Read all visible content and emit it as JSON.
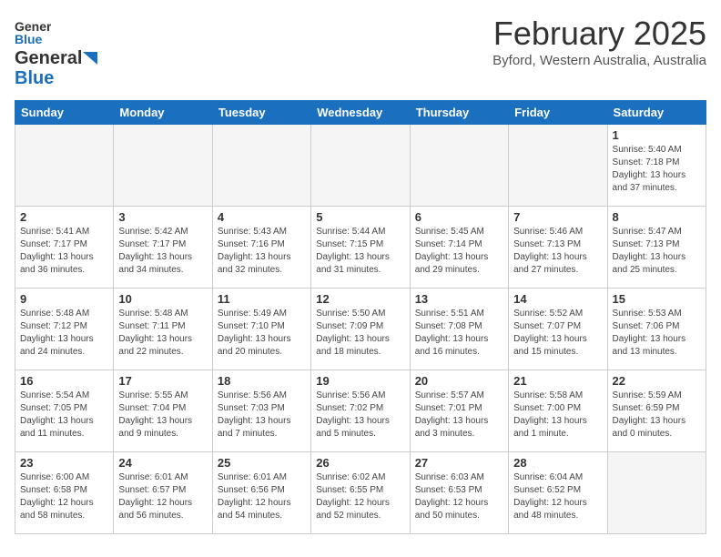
{
  "header": {
    "logo_general": "General",
    "logo_blue": "Blue",
    "month_title": "February 2025",
    "location": "Byford, Western Australia, Australia"
  },
  "weekdays": [
    "Sunday",
    "Monday",
    "Tuesday",
    "Wednesday",
    "Thursday",
    "Friday",
    "Saturday"
  ],
  "weeks": [
    [
      {
        "day": "",
        "info": ""
      },
      {
        "day": "",
        "info": ""
      },
      {
        "day": "",
        "info": ""
      },
      {
        "day": "",
        "info": ""
      },
      {
        "day": "",
        "info": ""
      },
      {
        "day": "",
        "info": ""
      },
      {
        "day": "1",
        "info": "Sunrise: 5:40 AM\nSunset: 7:18 PM\nDaylight: 13 hours\nand 37 minutes."
      }
    ],
    [
      {
        "day": "2",
        "info": "Sunrise: 5:41 AM\nSunset: 7:17 PM\nDaylight: 13 hours\nand 36 minutes."
      },
      {
        "day": "3",
        "info": "Sunrise: 5:42 AM\nSunset: 7:17 PM\nDaylight: 13 hours\nand 34 minutes."
      },
      {
        "day": "4",
        "info": "Sunrise: 5:43 AM\nSunset: 7:16 PM\nDaylight: 13 hours\nand 32 minutes."
      },
      {
        "day": "5",
        "info": "Sunrise: 5:44 AM\nSunset: 7:15 PM\nDaylight: 13 hours\nand 31 minutes."
      },
      {
        "day": "6",
        "info": "Sunrise: 5:45 AM\nSunset: 7:14 PM\nDaylight: 13 hours\nand 29 minutes."
      },
      {
        "day": "7",
        "info": "Sunrise: 5:46 AM\nSunset: 7:13 PM\nDaylight: 13 hours\nand 27 minutes."
      },
      {
        "day": "8",
        "info": "Sunrise: 5:47 AM\nSunset: 7:13 PM\nDaylight: 13 hours\nand 25 minutes."
      }
    ],
    [
      {
        "day": "9",
        "info": "Sunrise: 5:48 AM\nSunset: 7:12 PM\nDaylight: 13 hours\nand 24 minutes."
      },
      {
        "day": "10",
        "info": "Sunrise: 5:48 AM\nSunset: 7:11 PM\nDaylight: 13 hours\nand 22 minutes."
      },
      {
        "day": "11",
        "info": "Sunrise: 5:49 AM\nSunset: 7:10 PM\nDaylight: 13 hours\nand 20 minutes."
      },
      {
        "day": "12",
        "info": "Sunrise: 5:50 AM\nSunset: 7:09 PM\nDaylight: 13 hours\nand 18 minutes."
      },
      {
        "day": "13",
        "info": "Sunrise: 5:51 AM\nSunset: 7:08 PM\nDaylight: 13 hours\nand 16 minutes."
      },
      {
        "day": "14",
        "info": "Sunrise: 5:52 AM\nSunset: 7:07 PM\nDaylight: 13 hours\nand 15 minutes."
      },
      {
        "day": "15",
        "info": "Sunrise: 5:53 AM\nSunset: 7:06 PM\nDaylight: 13 hours\nand 13 minutes."
      }
    ],
    [
      {
        "day": "16",
        "info": "Sunrise: 5:54 AM\nSunset: 7:05 PM\nDaylight: 13 hours\nand 11 minutes."
      },
      {
        "day": "17",
        "info": "Sunrise: 5:55 AM\nSunset: 7:04 PM\nDaylight: 13 hours\nand 9 minutes."
      },
      {
        "day": "18",
        "info": "Sunrise: 5:56 AM\nSunset: 7:03 PM\nDaylight: 13 hours\nand 7 minutes."
      },
      {
        "day": "19",
        "info": "Sunrise: 5:56 AM\nSunset: 7:02 PM\nDaylight: 13 hours\nand 5 minutes."
      },
      {
        "day": "20",
        "info": "Sunrise: 5:57 AM\nSunset: 7:01 PM\nDaylight: 13 hours\nand 3 minutes."
      },
      {
        "day": "21",
        "info": "Sunrise: 5:58 AM\nSunset: 7:00 PM\nDaylight: 13 hours\nand 1 minute."
      },
      {
        "day": "22",
        "info": "Sunrise: 5:59 AM\nSunset: 6:59 PM\nDaylight: 13 hours\nand 0 minutes."
      }
    ],
    [
      {
        "day": "23",
        "info": "Sunrise: 6:00 AM\nSunset: 6:58 PM\nDaylight: 12 hours\nand 58 minutes."
      },
      {
        "day": "24",
        "info": "Sunrise: 6:01 AM\nSunset: 6:57 PM\nDaylight: 12 hours\nand 56 minutes."
      },
      {
        "day": "25",
        "info": "Sunrise: 6:01 AM\nSunset: 6:56 PM\nDaylight: 12 hours\nand 54 minutes."
      },
      {
        "day": "26",
        "info": "Sunrise: 6:02 AM\nSunset: 6:55 PM\nDaylight: 12 hours\nand 52 minutes."
      },
      {
        "day": "27",
        "info": "Sunrise: 6:03 AM\nSunset: 6:53 PM\nDaylight: 12 hours\nand 50 minutes."
      },
      {
        "day": "28",
        "info": "Sunrise: 6:04 AM\nSunset: 6:52 PM\nDaylight: 12 hours\nand 48 minutes."
      },
      {
        "day": "",
        "info": ""
      }
    ]
  ]
}
